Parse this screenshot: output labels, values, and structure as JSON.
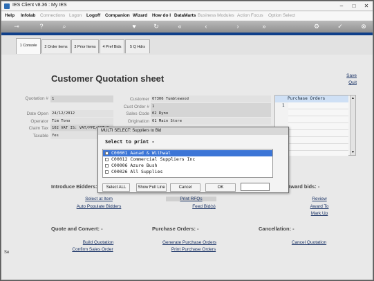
{
  "window": {
    "title": "IES Client v8.36 : My IES",
    "controls": [
      "–",
      "□",
      "✕"
    ]
  },
  "menu": [
    "Help",
    "Infolab",
    "Connections",
    "Logon",
    "Logoff",
    "Companion",
    "Wizard",
    "How do I",
    "DataMarts",
    "Business Modules",
    "Action Focus",
    "Option Select"
  ],
  "tabs": [
    "1 Console",
    "2 Order items",
    "3 Prior Items",
    "4 Pref Bids",
    "5 Q Hdrs"
  ],
  "sheet": {
    "title": "Customer Quotation sheet",
    "save": "Save",
    "quit": "Quit"
  },
  "fields_left": [
    {
      "label": "Quotation #",
      "value": "1"
    },
    {
      "label": "Date Open",
      "value": "24/12/2012"
    },
    {
      "label": "Operator",
      "value": "Tim Tono"
    },
    {
      "label": "Claim Tax",
      "value": "102 VAT IS: VAT/PPE/GST/C"
    },
    {
      "label": "Taxable",
      "value": "Yes"
    }
  ],
  "fields_mid": [
    {
      "label": "Customer",
      "value": "07306 Tumblewood"
    },
    {
      "label": "Cust Order #",
      "value": "1"
    },
    {
      "label": "Sales Code",
      "value": "02 Ryno"
    },
    {
      "label": "Origination",
      "value": "01 Main Store"
    }
  ],
  "purchase_orders": {
    "header": "Purchase Orders",
    "row_number": "1"
  },
  "sections": {
    "introduce": "Introduce Bidders: -",
    "award": "Award bids: -",
    "quote": "Quote and Convert: -",
    "po": "Purchase Orders: -",
    "cancel": "Cancellation: -"
  },
  "links": {
    "select_item": "Select at Item",
    "auto_populate": "Auto Populate Bidders",
    "print_rfqs": "Print RFQs",
    "feed_bids": "Feed Bid(s)",
    "review": "Review",
    "award_to": "Award To",
    "mark_up": "Mark Up",
    "build_quotation": "Build Quotation",
    "confirm_sales": "Confirm Sales Order",
    "generate_po": "Generate Purchase Orders",
    "print_po": "Print Purchase Orders",
    "cancel_quotation": "Cancel Quotation"
  },
  "dialog": {
    "title": "MULTI SELECT: Suppliers to Bid",
    "heading": "Select to print -",
    "items": [
      "C00001 Aanad & Withwal",
      "C00012 Commercial Suppliers Inc",
      "C00006 Azure Bush",
      "C00026 All Supplies"
    ],
    "selected_index": 0,
    "buttons": {
      "select_all": "Select ALL",
      "show_full": "Show Full Line",
      "cancel": "Cancel",
      "ok": "OK"
    }
  },
  "colors": {
    "accent": "#0f3f8a",
    "selection": "#3c75d6",
    "link": "#1a3366"
  }
}
